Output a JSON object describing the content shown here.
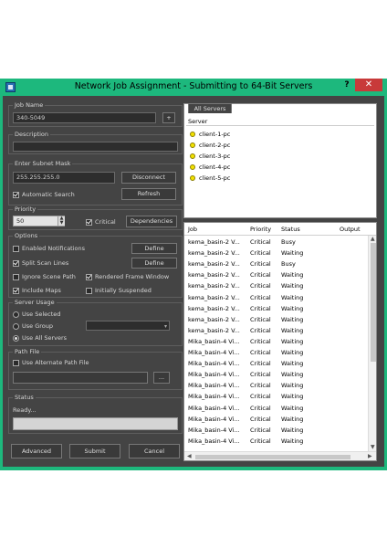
{
  "window": {
    "title": "Network Job Assignment - Submitting to 64-Bit Servers",
    "help": "?",
    "close": "✕"
  },
  "job_name": {
    "label": "Job Name",
    "value": "340-5049",
    "plus": "+"
  },
  "description": {
    "label": "Description",
    "value": ""
  },
  "subnet": {
    "label": "Enter Subnet Mask",
    "value": "255.255.255.0",
    "connect": "Disconnect",
    "auto_search": "Automatic Search",
    "refresh": "Refresh"
  },
  "priority": {
    "label": "Priority",
    "value": "50",
    "critical": "Critical",
    "dependencies": "Dependencies"
  },
  "options": {
    "label": "Options",
    "enabled_notifications": "Enabled Notifications",
    "define1": "Define",
    "split_scan_lines": "Split Scan Lines",
    "define2": "Define",
    "ignore_scene_path": "Ignore Scene Path",
    "rendered_frame_window": "Rendered Frame Window",
    "include_maps": "Include Maps",
    "initially_suspended": "Initially Suspended"
  },
  "server_usage": {
    "label": "Server Usage",
    "use_selected": "Use Selected",
    "use_group": "Use Group",
    "use_all": "Use All Servers"
  },
  "path_file": {
    "label": "Path File",
    "use_alternate": "Use Alternate Path File",
    "browse": "..."
  },
  "status": {
    "label": "Status",
    "value": "Ready..."
  },
  "buttons": {
    "advanced": "Advanced",
    "submit": "Submit",
    "cancel": "Cancel"
  },
  "servers": {
    "tab": "All Servers",
    "header": "Server",
    "items": [
      "client-1-pc",
      "client-2-pc",
      "client-3-pc",
      "client-4-pc",
      "client-5-pc"
    ],
    "status_color": "#f2e200"
  },
  "jobs": {
    "columns": [
      "Job",
      "Priority",
      "Status",
      "Output"
    ],
    "rows": [
      {
        "job": "kema_basin-2 V...",
        "priority": "Critical",
        "status": "Busy"
      },
      {
        "job": "kema_basin-2 V...",
        "priority": "Critical",
        "status": "Waiting"
      },
      {
        "job": "kema_basin-2 V...",
        "priority": "Critical",
        "status": "Busy"
      },
      {
        "job": "kema_basin-2 V...",
        "priority": "Critical",
        "status": "Waiting"
      },
      {
        "job": "kema_basin-2 V...",
        "priority": "Critical",
        "status": "Waiting"
      },
      {
        "job": "kema_basin-2 V...",
        "priority": "Critical",
        "status": "Waiting"
      },
      {
        "job": "kema_basin-2 V...",
        "priority": "Critical",
        "status": "Waiting"
      },
      {
        "job": "kema_basin-2 V...",
        "priority": "Critical",
        "status": "Waiting"
      },
      {
        "job": "kema_basin-2 V...",
        "priority": "Critical",
        "status": "Waiting"
      },
      {
        "job": "Mika_basin-4 Vi...",
        "priority": "Critical",
        "status": "Waiting"
      },
      {
        "job": "Mika_basin-4 Vi...",
        "priority": "Critical",
        "status": "Waiting"
      },
      {
        "job": "Mika_basin-4 Vi...",
        "priority": "Critical",
        "status": "Waiting"
      },
      {
        "job": "Mika_basin-4 Vi...",
        "priority": "Critical",
        "status": "Waiting"
      },
      {
        "job": "Mika_basin-4 Vi...",
        "priority": "Critical",
        "status": "Waiting"
      },
      {
        "job": "Mika_basin-4 Vi...",
        "priority": "Critical",
        "status": "Waiting"
      },
      {
        "job": "Mika_basin-4 Vi...",
        "priority": "Critical",
        "status": "Waiting"
      },
      {
        "job": "Mika_basin-4 Vi...",
        "priority": "Critical",
        "status": "Waiting"
      },
      {
        "job": "Mika_basin-4 Vi...",
        "priority": "Critical",
        "status": "Waiting"
      },
      {
        "job": "Mika_basin-4 Vi...",
        "priority": "Critical",
        "status": "Waiting"
      }
    ]
  }
}
